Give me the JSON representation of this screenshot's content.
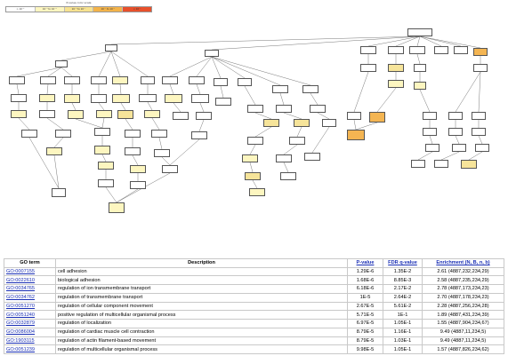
{
  "legend": {
    "title": "P-value color scale",
    "colors": [
      "#ffffff",
      "#fdf6c0",
      "#f7e290",
      "#f3b34a",
      "#e8502b"
    ],
    "labels": [
      "> 10⁻³",
      "10⁻³ to 10⁻⁵",
      "10⁻⁵ to 10⁻⁷",
      "10⁻⁷ to 10⁻⁹",
      "< 10⁻⁹"
    ]
  },
  "graph": {
    "node_colors": {
      "white": "#ffffff",
      "light": "#fdf6c0",
      "mid": "#f6e49a",
      "orange": "#f4b552"
    }
  },
  "table": {
    "headers": {
      "go_term": "GO term",
      "description": "Description",
      "pvalue": "P-value",
      "fdr": "FDR q-value",
      "enrichment": "Enrichment (N, B, n, b)"
    },
    "rows": [
      {
        "go_id": "GO:0007155",
        "description": "cell adhesion",
        "pvalue": "1.29E-6",
        "fdr": "1.35E-2",
        "enrichment": "2.61 (4887,232,234,29)"
      },
      {
        "go_id": "GO:0022610",
        "description": "biological adhesion",
        "pvalue": "1.68E-6",
        "fdr": "8.85E-3",
        "enrichment": "2.58 (4887,235,234,29)"
      },
      {
        "go_id": "GO:0034765",
        "description": "regulation of ion transmembrane transport",
        "pvalue": "6.18E-6",
        "fdr": "2.17E-2",
        "enrichment": "2.78 (4887,173,234,23)"
      },
      {
        "go_id": "GO:0034762",
        "description": "regulation of transmembrane transport",
        "pvalue": "1E-5",
        "fdr": "2.64E-2",
        "enrichment": "2.70 (4887,178,234,23)"
      },
      {
        "go_id": "GO:0051270",
        "description": "regulation of cellular component movement",
        "pvalue": "2.67E-5",
        "fdr": "5.61E-2",
        "enrichment": "2.28 (4887,256,234,28)"
      },
      {
        "go_id": "GO:0051240",
        "description": "positive regulation of multicellular organismal process",
        "pvalue": "5.71E-5",
        "fdr": "1E-1",
        "enrichment": "1.89 (4887,431,234,39)"
      },
      {
        "go_id": "GO:0032879",
        "description": "regulation of localization",
        "pvalue": "6.97E-5",
        "fdr": "1.05E-1",
        "enrichment": "1.55 (4887,904,234,67)"
      },
      {
        "go_id": "GO:0086004",
        "description": "regulation of cardiac muscle cell contraction",
        "pvalue": "8.79E-5",
        "fdr": "1.16E-1",
        "enrichment": "9.49 (4887,11,234,5)"
      },
      {
        "go_id": "GO:1903115",
        "description": "regulation of actin filament-based movement",
        "pvalue": "8.79E-5",
        "fdr": "1.03E-1",
        "enrichment": "9.49 (4887,11,234,5)"
      },
      {
        "go_id": "GO:0051239",
        "description": "regulation of multicellular organismal process",
        "pvalue": "9.98E-5",
        "fdr": "1.05E-1",
        "enrichment": "1.57 (4887,826,234,62)"
      }
    ]
  }
}
